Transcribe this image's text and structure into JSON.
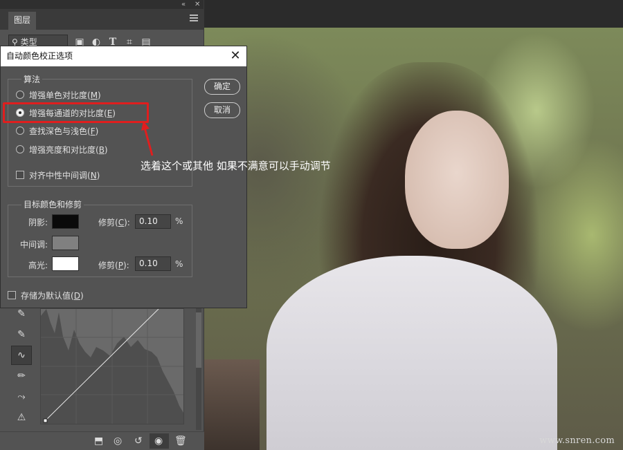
{
  "panel": {
    "collapse_glyph": "«",
    "close_glyph": "✕",
    "tab_label": "图层",
    "filter_placeholder": "类型",
    "filter_icon": "search-icon",
    "filter_tools": [
      "image-filter-icon",
      "adjustment-filter-icon",
      "text-filter-icon",
      "shape-filter-icon",
      "smart-object-filter-icon"
    ]
  },
  "dialog": {
    "title": "自动颜色校正选项",
    "algorithm": {
      "legend": "算法",
      "options": [
        {
          "label": "增强单色对比度(",
          "key": "M",
          "suffix": ")",
          "selected": false
        },
        {
          "label": "增强每通道的对比度(",
          "key": "E",
          "suffix": ")",
          "selected": true
        },
        {
          "label": "查找深色与浅色(",
          "key": "F",
          "suffix": ")",
          "selected": false
        },
        {
          "label": "增强亮度和对比度(",
          "key": "B",
          "suffix": ")",
          "selected": false
        }
      ],
      "snap_neutral": {
        "label": "对齐中性中间调(",
        "key": "N",
        "suffix": ")",
        "checked": false
      }
    },
    "ok_label": "确定",
    "cancel_label": "取消",
    "target": {
      "legend": "目标颜色和修剪",
      "shadows_label": "阴影:",
      "shadows_color": "#0a0a0a",
      "shadows_clip_label": "修剪(",
      "shadows_clip_key": "C",
      "shadows_clip_suffix": "):",
      "shadows_clip_value": "0.10",
      "midtones_label": "中间调:",
      "midtones_color": "#808080",
      "highlights_label": "高光:",
      "highlights_color": "#ffffff",
      "highlights_clip_label": "修剪(",
      "highlights_clip_key": "P",
      "highlights_clip_suffix": "):",
      "highlights_clip_value": "0.10",
      "percent": "%"
    },
    "save_default": {
      "label": "存储为默认值(",
      "key": "D",
      "suffix": ")",
      "checked": false
    }
  },
  "annotation": {
    "text": "选着这个或其他    如果不满意可以手动调节",
    "color": "#e01e1e"
  },
  "watermark": "www.snren.com"
}
